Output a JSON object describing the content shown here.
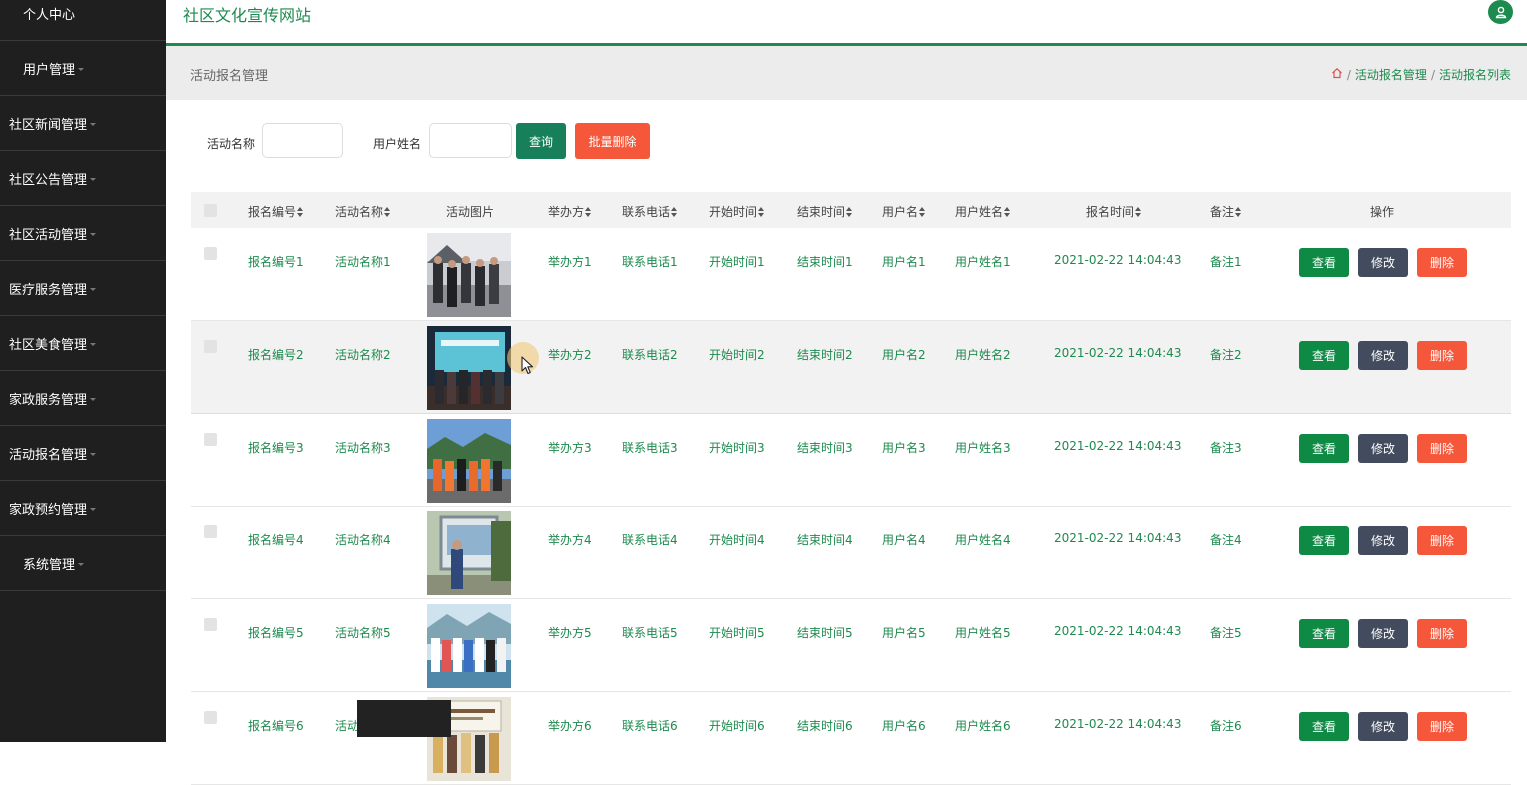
{
  "sidebar": {
    "items": [
      {
        "label": "个人中心"
      },
      {
        "label": "用户管理"
      },
      {
        "label": "社区新闻管理"
      },
      {
        "label": "社区公告管理"
      },
      {
        "label": "社区活动管理"
      },
      {
        "label": "医疗服务管理"
      },
      {
        "label": "社区美食管理"
      },
      {
        "label": "家政服务管理"
      },
      {
        "label": "活动报名管理"
      },
      {
        "label": "家政预约管理"
      },
      {
        "label": "系统管理"
      }
    ]
  },
  "header": {
    "site_title": "社区文化宣传网站",
    "user_icon": "user-icon",
    "accent_color": "#1d8a4e"
  },
  "breadcrumb": {
    "page_title": "活动报名管理",
    "home_icon": "home-icon",
    "path": [
      "活动报名管理",
      "活动报名列表"
    ],
    "separator": "/"
  },
  "search": {
    "activity_name_label": "活动名称",
    "activity_name_value": "",
    "user_fullname_label": "用户姓名",
    "user_fullname_value": "",
    "query_button": "查询",
    "batch_delete_button": "批量删除"
  },
  "table": {
    "columns": [
      "报名编号",
      "活动名称",
      "活动图片",
      "举办方",
      "联系电话",
      "开始时间",
      "结束时间",
      "用户名",
      "用户姓名",
      "报名时间",
      "备注",
      "操作"
    ],
    "rows": [
      {
        "no": "报名编号1",
        "name": "活动名称1",
        "organizer": "举办方1",
        "phone": "联系电话1",
        "start": "开始时间1",
        "end": "结束时间1",
        "username": "用户名1",
        "fullname": "用户姓名1",
        "signup_time": "2021-02-22 14:04:43",
        "remark": "备注1"
      },
      {
        "no": "报名编号2",
        "name": "活动名称2",
        "organizer": "举办方2",
        "phone": "联系电话2",
        "start": "开始时间2",
        "end": "结束时间2",
        "username": "用户名2",
        "fullname": "用户姓名2",
        "signup_time": "2021-02-22 14:04:43",
        "remark": "备注2"
      },
      {
        "no": "报名编号3",
        "name": "活动名称3",
        "organizer": "举办方3",
        "phone": "联系电话3",
        "start": "开始时间3",
        "end": "结束时间3",
        "username": "用户名3",
        "fullname": "用户姓名3",
        "signup_time": "2021-02-22 14:04:43",
        "remark": "备注3"
      },
      {
        "no": "报名编号4",
        "name": "活动名称4",
        "organizer": "举办方4",
        "phone": "联系电话4",
        "start": "开始时间4",
        "end": "结束时间4",
        "username": "用户名4",
        "fullname": "用户姓名4",
        "signup_time": "2021-02-22 14:04:43",
        "remark": "备注4"
      },
      {
        "no": "报名编号5",
        "name": "活动名称5",
        "organizer": "举办方5",
        "phone": "联系电话5",
        "start": "开始时间5",
        "end": "结束时间5",
        "username": "用户名5",
        "fullname": "用户姓名5",
        "signup_time": "2021-02-22 14:04:43",
        "remark": "备注5"
      },
      {
        "no": "报名编号6",
        "name": "活动",
        "organizer": "举办方6",
        "phone": "联系电话6",
        "start": "开始时间6",
        "end": "结束时间6",
        "username": "用户名6",
        "fullname": "用户姓名6",
        "signup_time": "2021-02-22 14:04:43",
        "remark": "备注6"
      }
    ],
    "actions": {
      "view": "查看",
      "edit": "修改",
      "delete": "删除"
    },
    "action_colors": {
      "view": "#0f8a45",
      "edit": "#434c5e",
      "delete": "#f5573b"
    }
  }
}
